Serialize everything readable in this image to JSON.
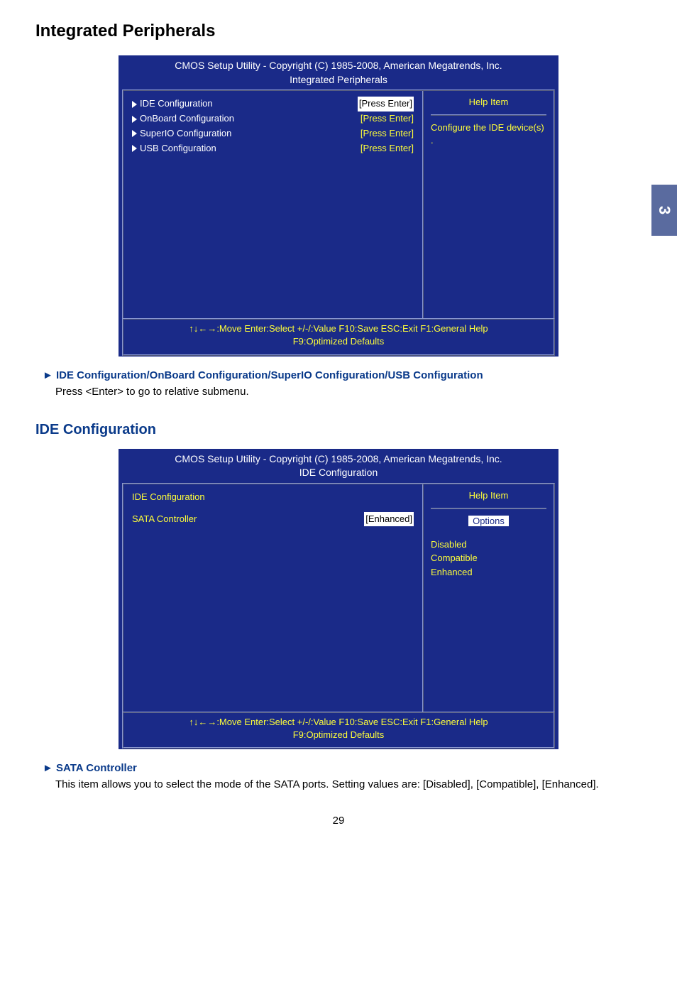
{
  "page_title": "Integrated Peripherals",
  "side_tab": "3",
  "bios1": {
    "title_line1": "CMOS Setup Utility - Copyright (C) 1985-2008, American Megatrends, Inc.",
    "title_line2": "Integrated Peripherals",
    "items": [
      {
        "label": "IDE Configuration",
        "value": "[Press Enter]",
        "selected": true,
        "white": true
      },
      {
        "label": "OnBoard Configuration",
        "value": "[Press Enter]",
        "selected": false,
        "white": true
      },
      {
        "label": "SuperIO Configuration",
        "value": "[Press Enter]",
        "selected": false,
        "white": true
      },
      {
        "label": "USB Configuration",
        "value": "[Press Enter]",
        "selected": false,
        "white": true
      }
    ],
    "help_title": "Help Item",
    "help_body": "Configure the IDE device(s) .",
    "footer_line1": "↑↓←→:Move   Enter:Select   +/-/:Value   F10:Save   ESC:Exit   F1:General Help",
    "footer_line2": "F9:Optimized Defaults"
  },
  "note1": {
    "head": "► IDE Configuration/OnBoard Configuration/SuperIO Configuration/USB Configuration",
    "body": "Press <Enter> to go to relative submenu."
  },
  "section2_title": "IDE Configuration",
  "bios2": {
    "title_line1": "CMOS Setup Utility - Copyright (C) 1985-2008, American Megatrends, Inc.",
    "title_line2": "IDE Configuration",
    "header_label": "IDE Configuration",
    "item_label": "SATA Controller",
    "item_value": "[Enhanced]",
    "help_title": "Help Item",
    "options_label": "Options",
    "options": [
      "Disabled",
      "Compatible",
      "Enhanced"
    ],
    "footer_line1": "↑↓←→:Move   Enter:Select   +/-/:Value   F10:Save   ESC:Exit   F1:General Help",
    "footer_line2": "F9:Optimized Defaults"
  },
  "note2": {
    "head": "► SATA Controller",
    "body": "This item allows you to select the mode of the SATA ports. Setting values are: [Disabled], [Compatible], [Enhanced]."
  },
  "page_no": "29"
}
